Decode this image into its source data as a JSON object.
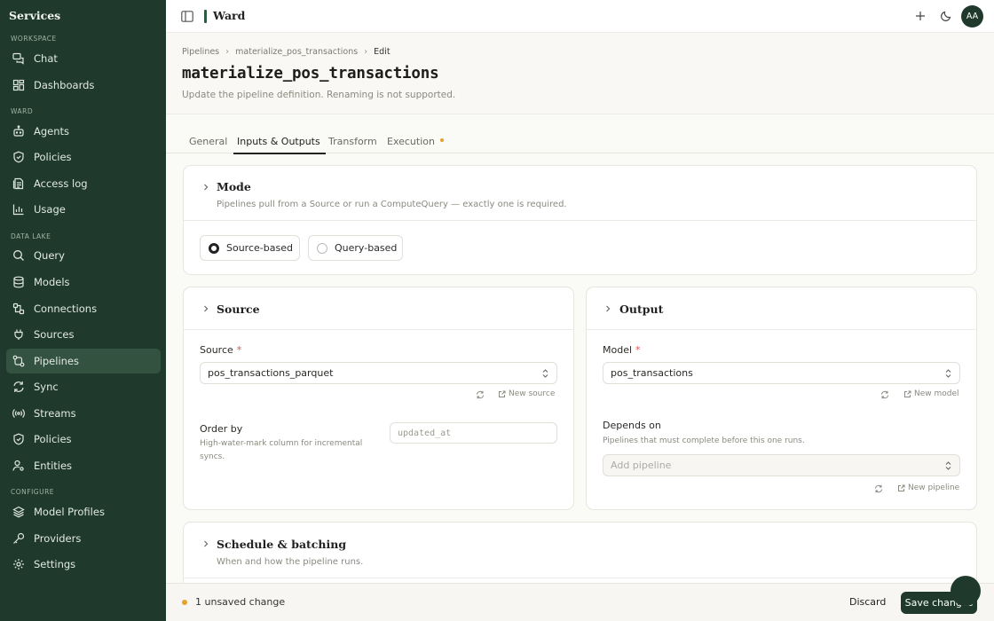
{
  "sidebar": {
    "title": "Services",
    "sections": {
      "workspace": "WORKSPACE",
      "ward": "WARD",
      "data_lake": "DATA LAKE",
      "configure": "CONFIGURE"
    },
    "items": {
      "chat": "Chat",
      "dashboards": "Dashboards",
      "agents": "Agents",
      "policies": "Policies",
      "access_log": "Access log",
      "usage": "Usage",
      "query": "Query",
      "models": "Models",
      "connections": "Connections",
      "sources": "Sources",
      "pipelines": "Pipelines",
      "sync": "Sync",
      "streams": "Streams",
      "policies2": "Policies",
      "entities": "Entities",
      "model_profiles": "Model Profiles",
      "providers": "Providers",
      "settings": "Settings"
    },
    "active": "Pipelines"
  },
  "topbar": {
    "brand": "Ward",
    "avatar": "AA"
  },
  "breadcrumb": {
    "root": "Pipelines",
    "item": "materialize_pos_transactions",
    "current": "Edit"
  },
  "page": {
    "title": "materialize_pos_transactions",
    "subtitle": "Update the pipeline definition. Renaming is not supported."
  },
  "tabs": {
    "general": "General",
    "io": "Inputs & Outputs",
    "transform": "Transform",
    "execution": "Execution"
  },
  "mode": {
    "title": "Mode",
    "subtitle": "Pipelines pull from a Source or run a ComputeQuery — exactly one is required.",
    "source_based": "Source-based",
    "query_based": "Query-based",
    "selected": "Source-based"
  },
  "source": {
    "title": "Source",
    "label": "Source",
    "value": "pos_transactions_parquet",
    "new_link": "New source",
    "order_by_label": "Order by",
    "order_by_hint": "High-water-mark column for incremental syncs.",
    "order_by_placeholder": "updated_at"
  },
  "output": {
    "title": "Output",
    "model_label": "Model",
    "model_value": "pos_transactions",
    "new_model": "New model",
    "depends_label": "Depends on",
    "depends_hint": "Pipelines that must complete before this one runs.",
    "depends_placeholder": "Add pipeline",
    "new_pipeline": "New pipeline"
  },
  "schedule": {
    "title": "Schedule & batching",
    "subtitle": "When and how the pipeline runs."
  },
  "footer": {
    "unsaved": "1 unsaved change",
    "discard": "Discard",
    "save": "Save changes"
  },
  "colors": {
    "sidebar_bg": "#1f3a2c",
    "accent_dot": "#e6a12b",
    "required": "#d9534f"
  }
}
